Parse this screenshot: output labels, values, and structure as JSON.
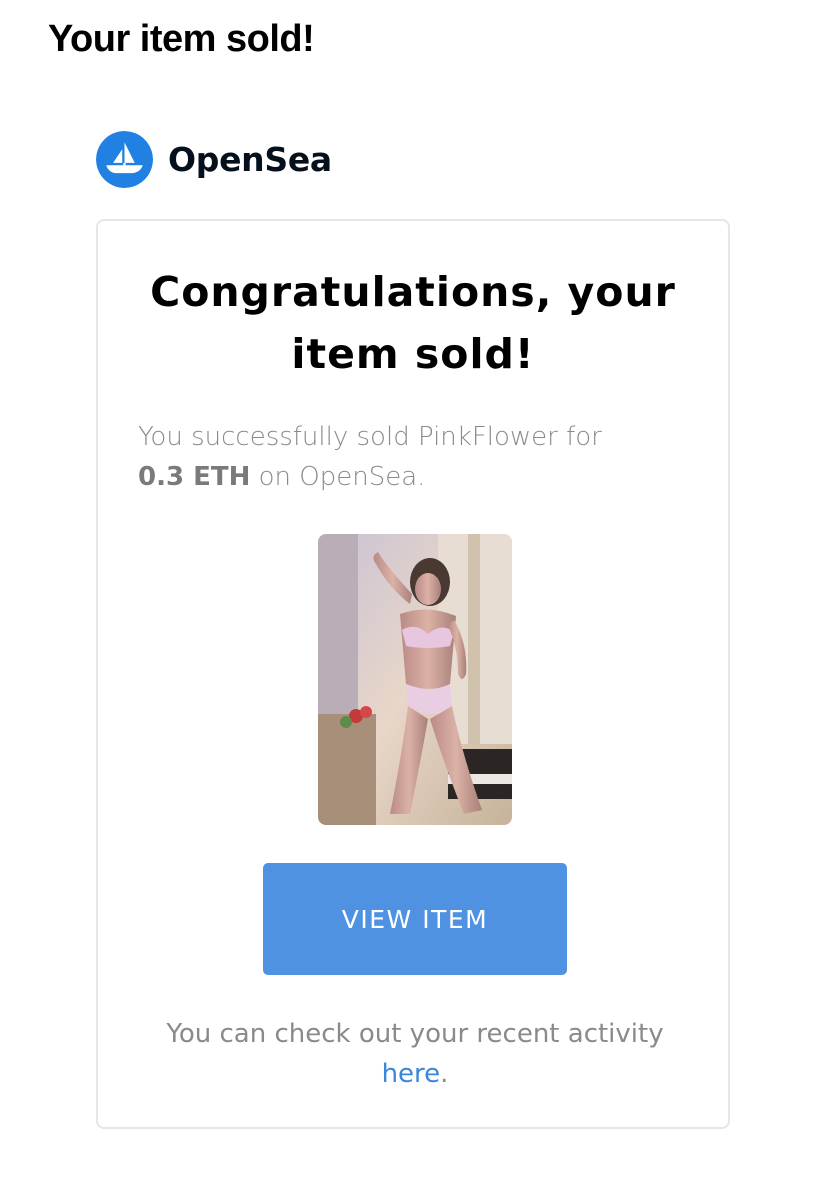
{
  "email": {
    "subject": "Your item sold!"
  },
  "brand": {
    "name": "OpenSea",
    "color": "#2081E2"
  },
  "card": {
    "heading_line1": "Congratulations, your",
    "heading_line2": "item sold!",
    "message_prefix": "You successfully sold PinkFlower for",
    "price": "0.3 ETH",
    "message_suffix": " on OpenSea.",
    "item_name": "PinkFlower",
    "view_button_label": "VIEW ITEM",
    "footer_text": "You can check out your recent activity",
    "footer_link": "here",
    "footer_period": "."
  },
  "colors": {
    "button": "#4F92E1",
    "link": "#3B86DC",
    "muted_text": "#8A8A8A"
  },
  "icons": {
    "brand_logo": "opensea-ship-icon"
  }
}
